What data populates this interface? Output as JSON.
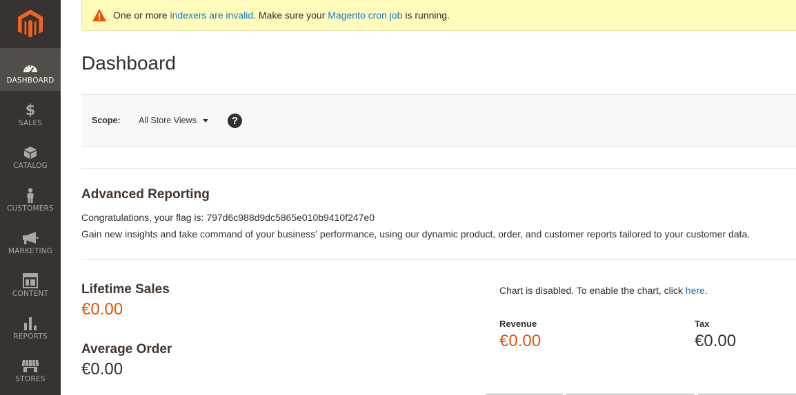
{
  "sidebar": {
    "logo": "magento-logo",
    "items": [
      {
        "label": "DASHBOARD",
        "icon": "dashboard-icon",
        "active": true
      },
      {
        "label": "SALES",
        "icon": "dollar-icon"
      },
      {
        "label": "CATALOG",
        "icon": "cube-icon"
      },
      {
        "label": "CUSTOMERS",
        "icon": "person-icon"
      },
      {
        "label": "MARKETING",
        "icon": "megaphone-icon"
      },
      {
        "label": "CONTENT",
        "icon": "layout-icon"
      },
      {
        "label": "REPORTS",
        "icon": "bar-chart-icon"
      },
      {
        "label": "STORES",
        "icon": "store-icon"
      }
    ]
  },
  "notice": {
    "prefix": "One or more ",
    "link1": "indexers are invalid",
    "middle": ". Make sure your ",
    "link2": "Magento cron job",
    "suffix": " is running."
  },
  "page_title": "Dashboard",
  "scope": {
    "label": "Scope:",
    "selected": "All Store Views",
    "help": "?"
  },
  "advanced_reporting": {
    "title": "Advanced Reporting",
    "flag_line": "Congratulations, your flag is: 797d6c988d9dc5865e010b9410f247e0",
    "desc": "Gain new insights and take command of your business' performance, using our dynamic product, order, and customer reports tailored to your customer data."
  },
  "stats": {
    "lifetime_label": "Lifetime Sales",
    "lifetime_value": "€0.00",
    "average_label": "Average Order",
    "average_value": "€0.00"
  },
  "chart": {
    "msg_prefix": "Chart is disabled. To enable the chart, click ",
    "msg_link": "here",
    "msg_suffix": "."
  },
  "totals": {
    "revenue_label": "Revenue",
    "revenue_value": "€0.00",
    "tax_label": "Tax",
    "tax_value": "€0.00"
  },
  "colors": {
    "sidebar_bg": "#373330",
    "sidebar_active": "#524d49",
    "accent_orange": "#eb5202",
    "link_blue": "#1979c3",
    "notice_bg": "#fffbbb"
  }
}
